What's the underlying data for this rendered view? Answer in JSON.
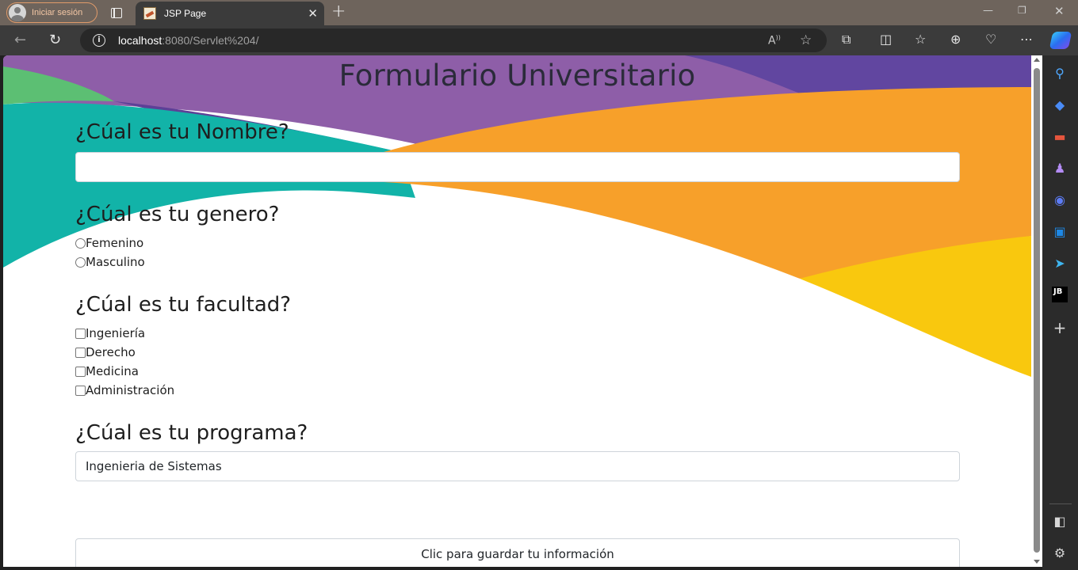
{
  "browser": {
    "profile_label": "Iniciar sesión",
    "tab_title": "JSP Page",
    "url_host": "localhost",
    "url_rest": ":8080/Servlet%204/"
  },
  "page": {
    "title": "Formulario Universitario",
    "name_question": "¿Cúal es tu Nombre?",
    "name_value": "",
    "gender_question": "¿Cúal es tu genero?",
    "gender_options": [
      "Femenino",
      "Masculino"
    ],
    "faculty_question": "¿Cúal es tu facultad?",
    "faculty_options": [
      "Ingeniería",
      "Derecho",
      "Medicina",
      "Administración"
    ],
    "program_question": "¿Cúal es tu programa?",
    "program_value": "Ingenieria de Sistemas",
    "submit_label": "Clic para guardar tu información"
  },
  "colors": {
    "purple": "#8e5ea8",
    "dark_purple": "#6146a0",
    "teal": "#12b3a8",
    "green": "#5cbf73",
    "orange": "#f7a02a",
    "yellow": "#f9c80e"
  }
}
